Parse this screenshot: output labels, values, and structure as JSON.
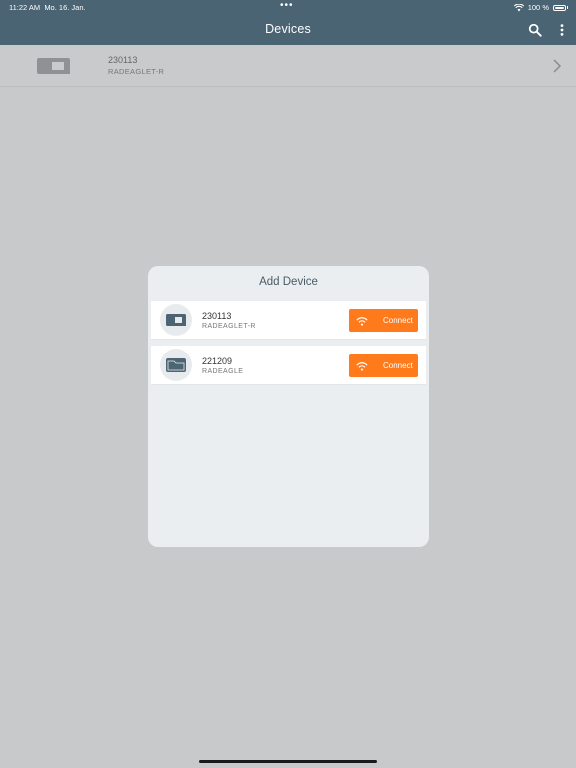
{
  "status_bar": {
    "time": "11:22 AM",
    "date": "Mo. 16. Jan.",
    "dots": "•••",
    "battery_text": "100 %"
  },
  "header": {
    "title": "Devices",
    "icons": [
      "search-icon",
      "more-vertical-icon"
    ]
  },
  "device_list": [
    {
      "id": "230113",
      "model": "RADEAGLET-R",
      "icon": "device-icon"
    }
  ],
  "modal": {
    "title": "Add Device",
    "devices": [
      {
        "id": "230113",
        "model": "RADEAGLET-R",
        "button_label": "Connect",
        "icon": "device-icon"
      },
      {
        "id": "221209",
        "model": "RADEAGLE",
        "button_label": "Connect",
        "icon": "device-icon"
      }
    ]
  },
  "colors": {
    "header_bg": "#4a6473",
    "accent": "#ff7a1a",
    "overlay_bg": "#c8c9cb",
    "modal_bg": "#ebeef0"
  }
}
